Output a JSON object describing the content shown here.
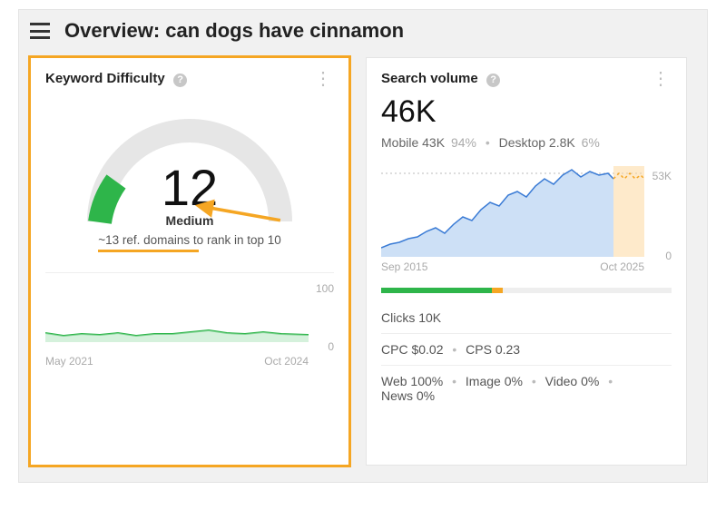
{
  "header": {
    "title": "Overview: can dogs have cinnamon"
  },
  "kd_card": {
    "title": "Keyword Difficulty",
    "score": "12",
    "tier": "Medium",
    "note": "~13 ref. domains to rank in top 10",
    "spark": {
      "top_tick": "100",
      "bottom_tick": "0",
      "date_start": "May 2021",
      "date_end": "Oct 2024"
    }
  },
  "sv_card": {
    "title": "Search volume",
    "volume": "46K",
    "mobile_label": "Mobile 43K",
    "mobile_pct": "94%",
    "desktop_label": "Desktop 2.8K",
    "desktop_pct": "6%",
    "chart_top_tick": "53K",
    "chart_bottom_tick": "0",
    "chart_date_start": "Sep 2015",
    "chart_date_end": "Oct 2025",
    "clicks_line": "Clicks 10K",
    "cpc_label": "CPC $0.02",
    "cps_label": "CPS 0.23",
    "dist": {
      "web": "Web 100%",
      "image": "Image 0%",
      "video": "Video 0%",
      "news": "News 0%"
    }
  },
  "chart_data": [
    {
      "type": "line",
      "title": "Keyword Difficulty over time",
      "x_range": [
        "May 2021",
        "Oct 2024"
      ],
      "ylim": [
        0,
        100
      ],
      "series": [
        {
          "name": "KD",
          "values": [
            14,
            10,
            12,
            11,
            13,
            10,
            12,
            12,
            15,
            17,
            13,
            12,
            14,
            12,
            11
          ]
        }
      ]
    },
    {
      "type": "area",
      "title": "Search volume over time",
      "x_range": [
        "Sep 2015",
        "Oct 2025"
      ],
      "ylim": [
        0,
        53000
      ],
      "series": [
        {
          "name": "Volume",
          "values": [
            4000,
            6000,
            7000,
            9000,
            11000,
            14000,
            16000,
            13000,
            18000,
            22000,
            20000,
            26000,
            30000,
            28000,
            34000,
            36000,
            33000,
            40000,
            44000,
            41000,
            46000,
            50000,
            47000,
            50000,
            48000,
            50000,
            46000,
            50000,
            46000
          ]
        }
      ],
      "annotations": [
        "forecast-band-last-10%"
      ]
    },
    {
      "type": "bar",
      "title": "Clicks distribution",
      "categories": [
        "green",
        "orange",
        "gray"
      ],
      "values": [
        38,
        4,
        58
      ]
    }
  ]
}
